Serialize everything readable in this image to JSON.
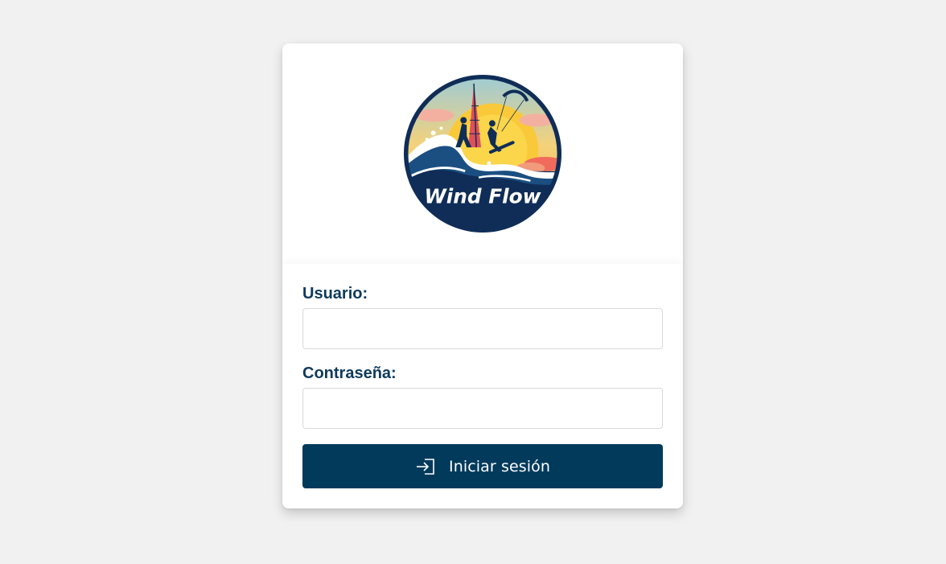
{
  "brand": {
    "logo_text": "Wind Flow",
    "logo_icon": "windsurf-kitesurf-logo"
  },
  "form": {
    "username_label": "Usuario:",
    "username_value": "",
    "password_label": "Contraseña:",
    "password_value": "",
    "submit_label": "Iniciar sesión",
    "submit_icon": "sign-in-icon"
  },
  "colors": {
    "background": "#f1f1f1",
    "card": "#ffffff",
    "label_text": "#0e3a5c",
    "button_bg": "#023a5c",
    "button_text": "#ffffff",
    "logo_navy": "#0f2d57",
    "logo_sun": "#f6c232"
  }
}
